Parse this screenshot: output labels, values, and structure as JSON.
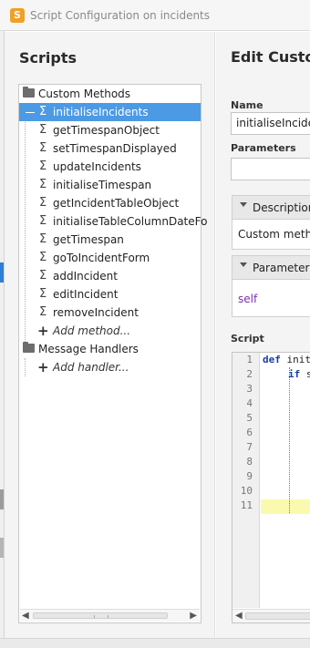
{
  "window": {
    "title": "Script Configuration on incidents",
    "app_icon_glyph": "S"
  },
  "scripts_panel": {
    "heading": "Scripts",
    "custom_methods_label": "Custom Methods",
    "methods": [
      "initialiseIncidents",
      "getTimespanObject",
      "setTimespanDisplayed",
      "updateIncidents",
      "initialiseTimespan",
      "getIncidentTableObject",
      "initialiseTableColumnDateFo",
      "getTimespan",
      "goToIncidentForm",
      "addIncident",
      "editIncident",
      "removeIncident"
    ],
    "selected_method": "initialiseIncidents",
    "add_method_label": "Add method...",
    "message_handlers_label": "Message Handlers",
    "add_handler_label": "Add handler...",
    "sigma_glyph": "Σ",
    "plus_glyph": "+"
  },
  "edit_panel": {
    "heading": "Edit Custon",
    "name_label": "Name",
    "name_value": "initialiseIncide",
    "parameters_label": "Parameters",
    "description_header": "Description",
    "description_text": "Custom metho",
    "parameters_header": "Parameters",
    "parameters_value": "self",
    "script_label": "Script"
  },
  "editor": {
    "line_numbers": [
      "1",
      "2",
      "3",
      "4",
      "5",
      "6",
      "7",
      "8",
      "9",
      "10",
      "11"
    ],
    "line1_keyword": "def",
    "line1_text": " initi",
    "line2_keyword": "if",
    "line2_text": " s"
  },
  "colors": {
    "selection": "#4c9ae3",
    "keyword": "#1a3ea8",
    "self_param": "#7a2fb0",
    "current_line": "#fafaaf",
    "app_icon": "#f0a026"
  },
  "icons": [
    "app-icon",
    "folder-icon",
    "sigma-icon",
    "plus-icon",
    "caret-down-icon",
    "scroll-left-arrow-icon",
    "scroll-right-arrow-icon"
  ]
}
